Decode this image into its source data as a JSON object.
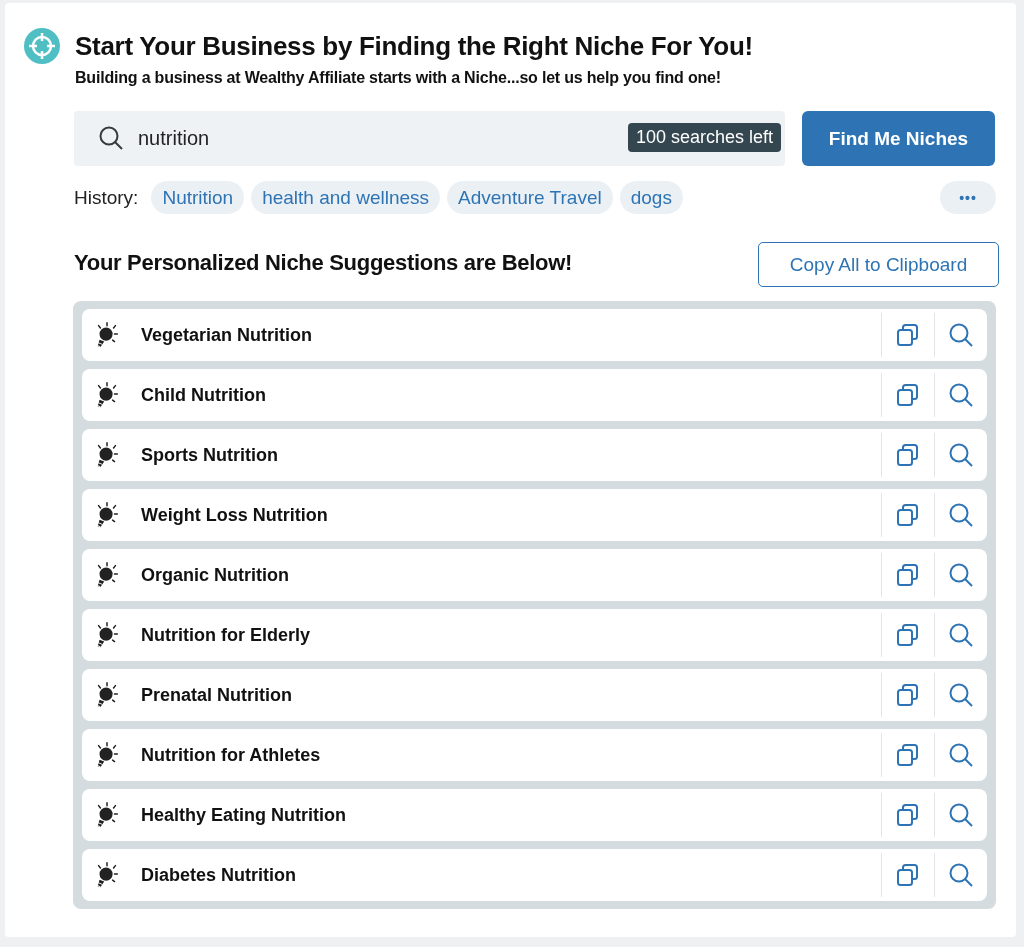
{
  "header": {
    "title": "Start Your Business by Finding the Right Niche For You!",
    "subtitle": "Building a business at Wealthy Affiliate starts with a Niche...so let us help you find one!"
  },
  "search": {
    "value": "nutrition",
    "badge": "100 searches left",
    "button": "Find Me Niches"
  },
  "history": {
    "label": "History:",
    "items": [
      "Nutrition",
      "health and wellness",
      "Adventure Travel",
      "dogs"
    ],
    "more": "•••"
  },
  "suggestions": {
    "heading": "Your Personalized Niche Suggestions are Below!",
    "copy_all": "Copy All to Clipboard",
    "items": [
      "Vegetarian Nutrition",
      "Child Nutrition",
      "Sports Nutrition",
      "Weight Loss Nutrition",
      "Organic Nutrition",
      "Nutrition for Elderly",
      "Prenatal Nutrition",
      "Nutrition for Athletes",
      "Healthy Eating Nutrition",
      "Diabetes Nutrition"
    ]
  }
}
